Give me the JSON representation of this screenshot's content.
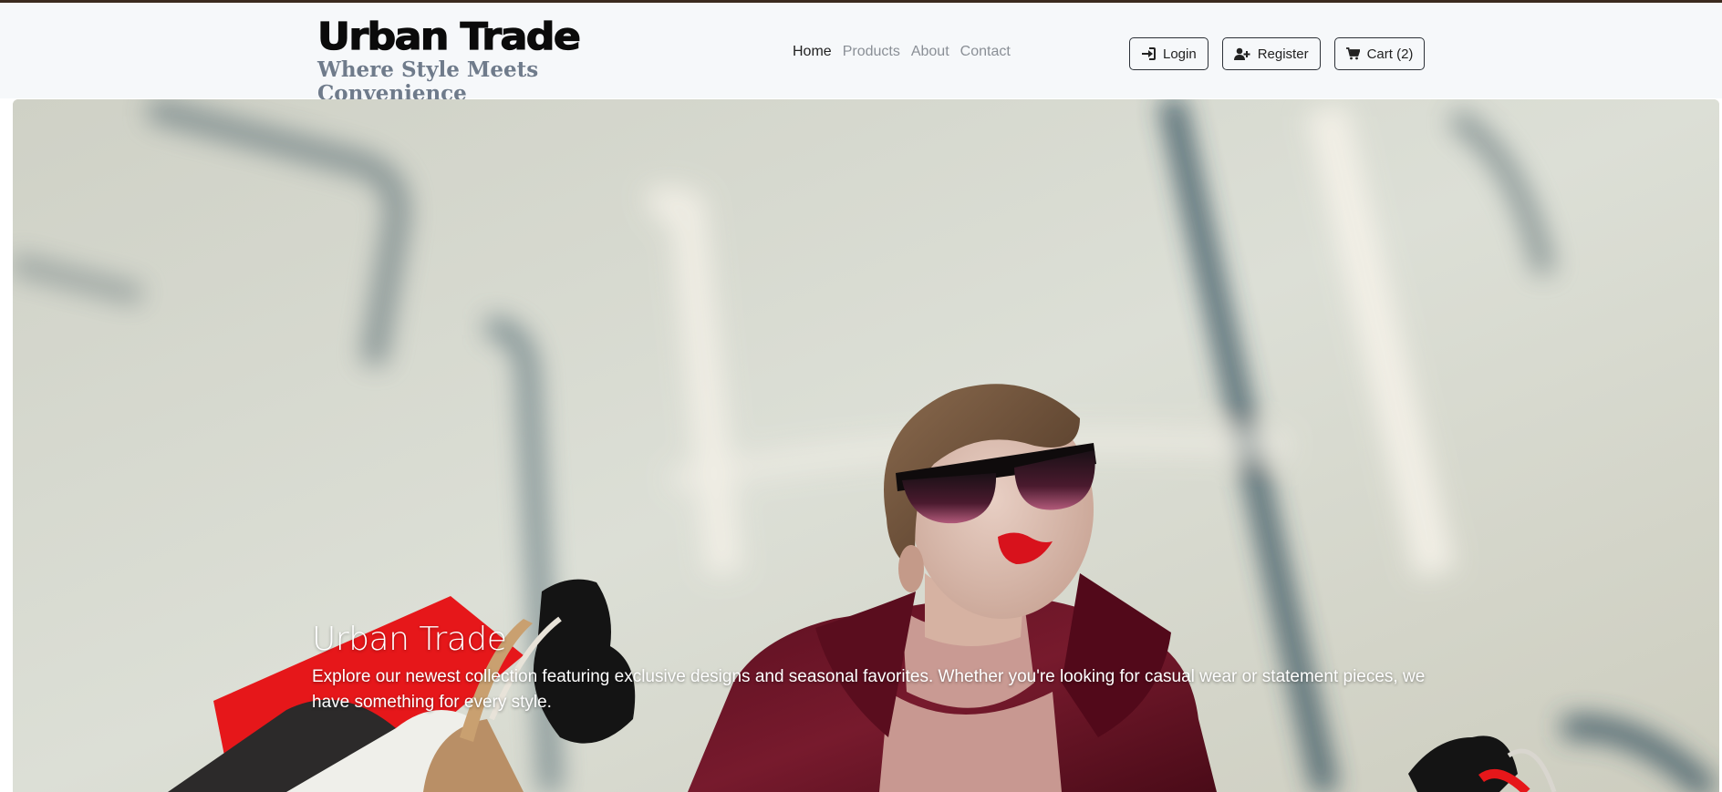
{
  "brand": {
    "title": "Urban Trade",
    "tagline": "Where Style Meets Convenience"
  },
  "nav": {
    "links": [
      {
        "label": "Home",
        "active": true
      },
      {
        "label": "Products",
        "active": false
      },
      {
        "label": "About",
        "active": false
      },
      {
        "label": "Contact",
        "active": false
      }
    ]
  },
  "actions": {
    "login": {
      "label": "Login",
      "icon": "sign-in-icon"
    },
    "register": {
      "label": "Register",
      "icon": "user-plus-icon"
    },
    "cart": {
      "label": "Cart (2)",
      "icon": "cart-icon"
    }
  },
  "hero": {
    "title": "Urban Trade",
    "description": "Explore our newest collection featuring exclusive designs and seasonal favorites. Whether you're looking for casual wear or statement pieces, we have something for every style."
  },
  "colors": {
    "top_rule": "#3b2a1e",
    "navbar_bg": "#f6f8fa",
    "tagline": "#6f7b8b",
    "coat": "#6e1528",
    "lips": "#d8121c"
  }
}
